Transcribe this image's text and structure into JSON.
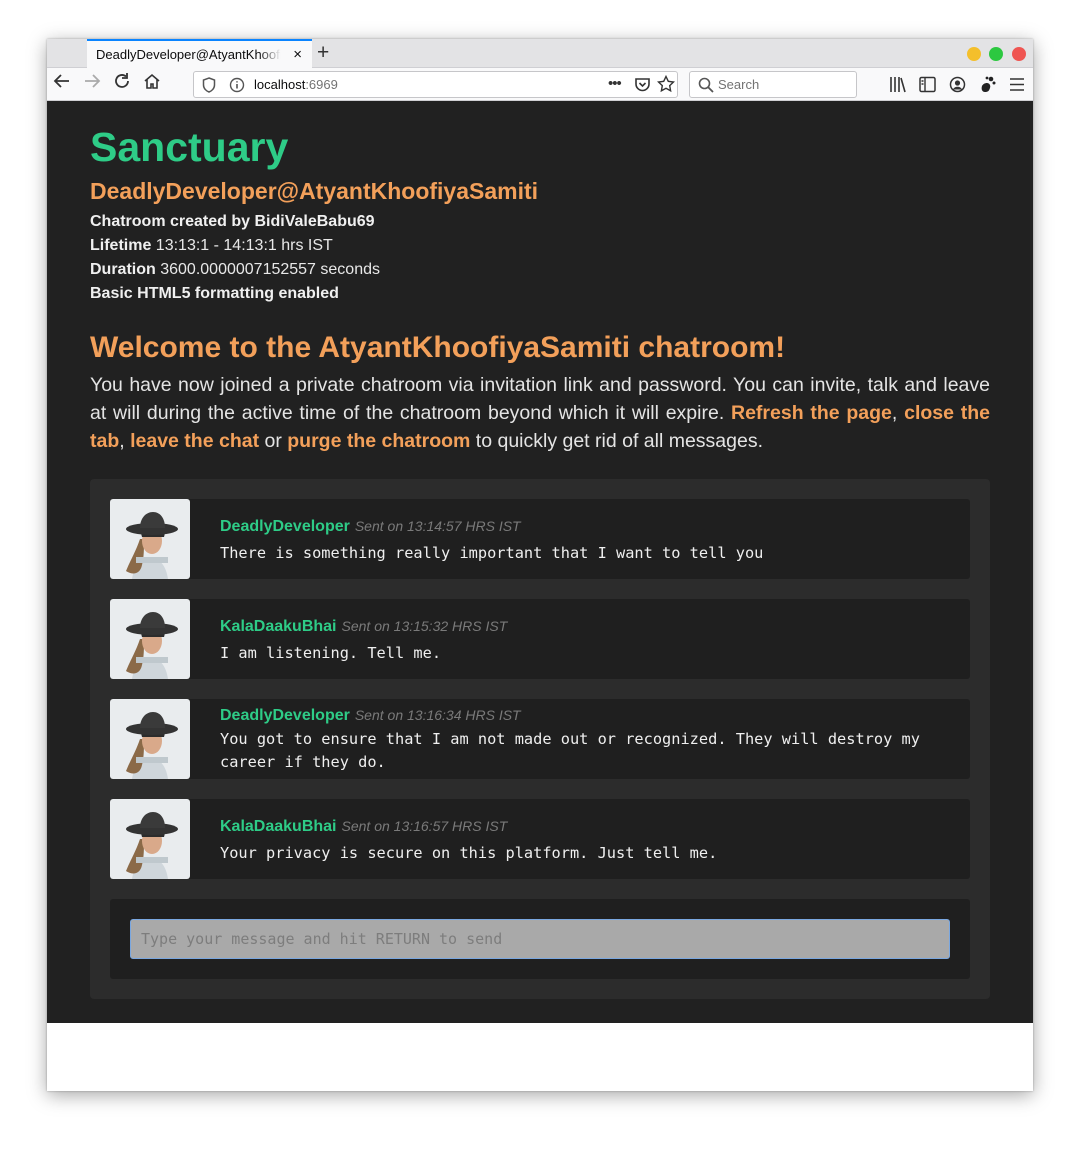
{
  "browser": {
    "tab_title": "DeadlyDeveloper@AtyantKhoofiyaSamiti",
    "tab_close_icon": "×",
    "new_tab_icon": "+",
    "url_host": "localhost",
    "url_port": ":6969",
    "search_placeholder": "Search",
    "window_controls": {
      "minimize": "#f4bf2b",
      "maximize": "#2cc840",
      "close": "#ef5552"
    }
  },
  "header": {
    "brand": "Sanctuary",
    "room_identity": "DeadlyDeveloper@AtyantKhoofiyaSamiti",
    "created_by": "Chatroom created by BidiValeBabu69",
    "lifetime_label": "Lifetime",
    "lifetime_value": "13:13:1 - 14:13:1 hrs IST",
    "duration_label": "Duration",
    "duration_value": "3600.0000007152557 seconds",
    "formatting_note": "Basic HTML5 formatting enabled"
  },
  "welcome": {
    "title": "Welcome to the AtyantKhoofiyaSamiti chatroom!",
    "intro_before": "You have now joined a private chatroom via invitation link and password. You can invite, talk and leave at will during the active time of the chatroom beyond which it will expire. ",
    "link_refresh": "Refresh the page",
    "sep1": ", ",
    "link_close": "close the tab",
    "sep2": ", ",
    "link_leave": "leave the chat",
    "sep3": " or ",
    "link_purge": "purge the chatroom",
    "intro_after": " to quickly get rid of all messages."
  },
  "messages": [
    {
      "sender": "DeadlyDeveloper",
      "sent": "Sent on 13:14:57 HRS IST",
      "text": "There is something really important that I want to tell you"
    },
    {
      "sender": "KalaDaakuBhai",
      "sent": "Sent on 13:15:32 HRS IST",
      "text": "I am listening. Tell me."
    },
    {
      "sender": "DeadlyDeveloper",
      "sent": "Sent on 13:16:34 HRS IST",
      "text": "You got to ensure that I am not made out or recognized. They will destroy my career if they do."
    },
    {
      "sender": "KalaDaakuBhai",
      "sent": "Sent on 13:16:57 HRS IST",
      "text": "Your privacy is secure on this platform. Just tell me."
    }
  ],
  "composer": {
    "placeholder": "Type your message and hit RETURN to send"
  },
  "colors": {
    "brand_green": "#2ecc87",
    "accent_orange": "#f3a05a",
    "page_bg": "#212121"
  }
}
